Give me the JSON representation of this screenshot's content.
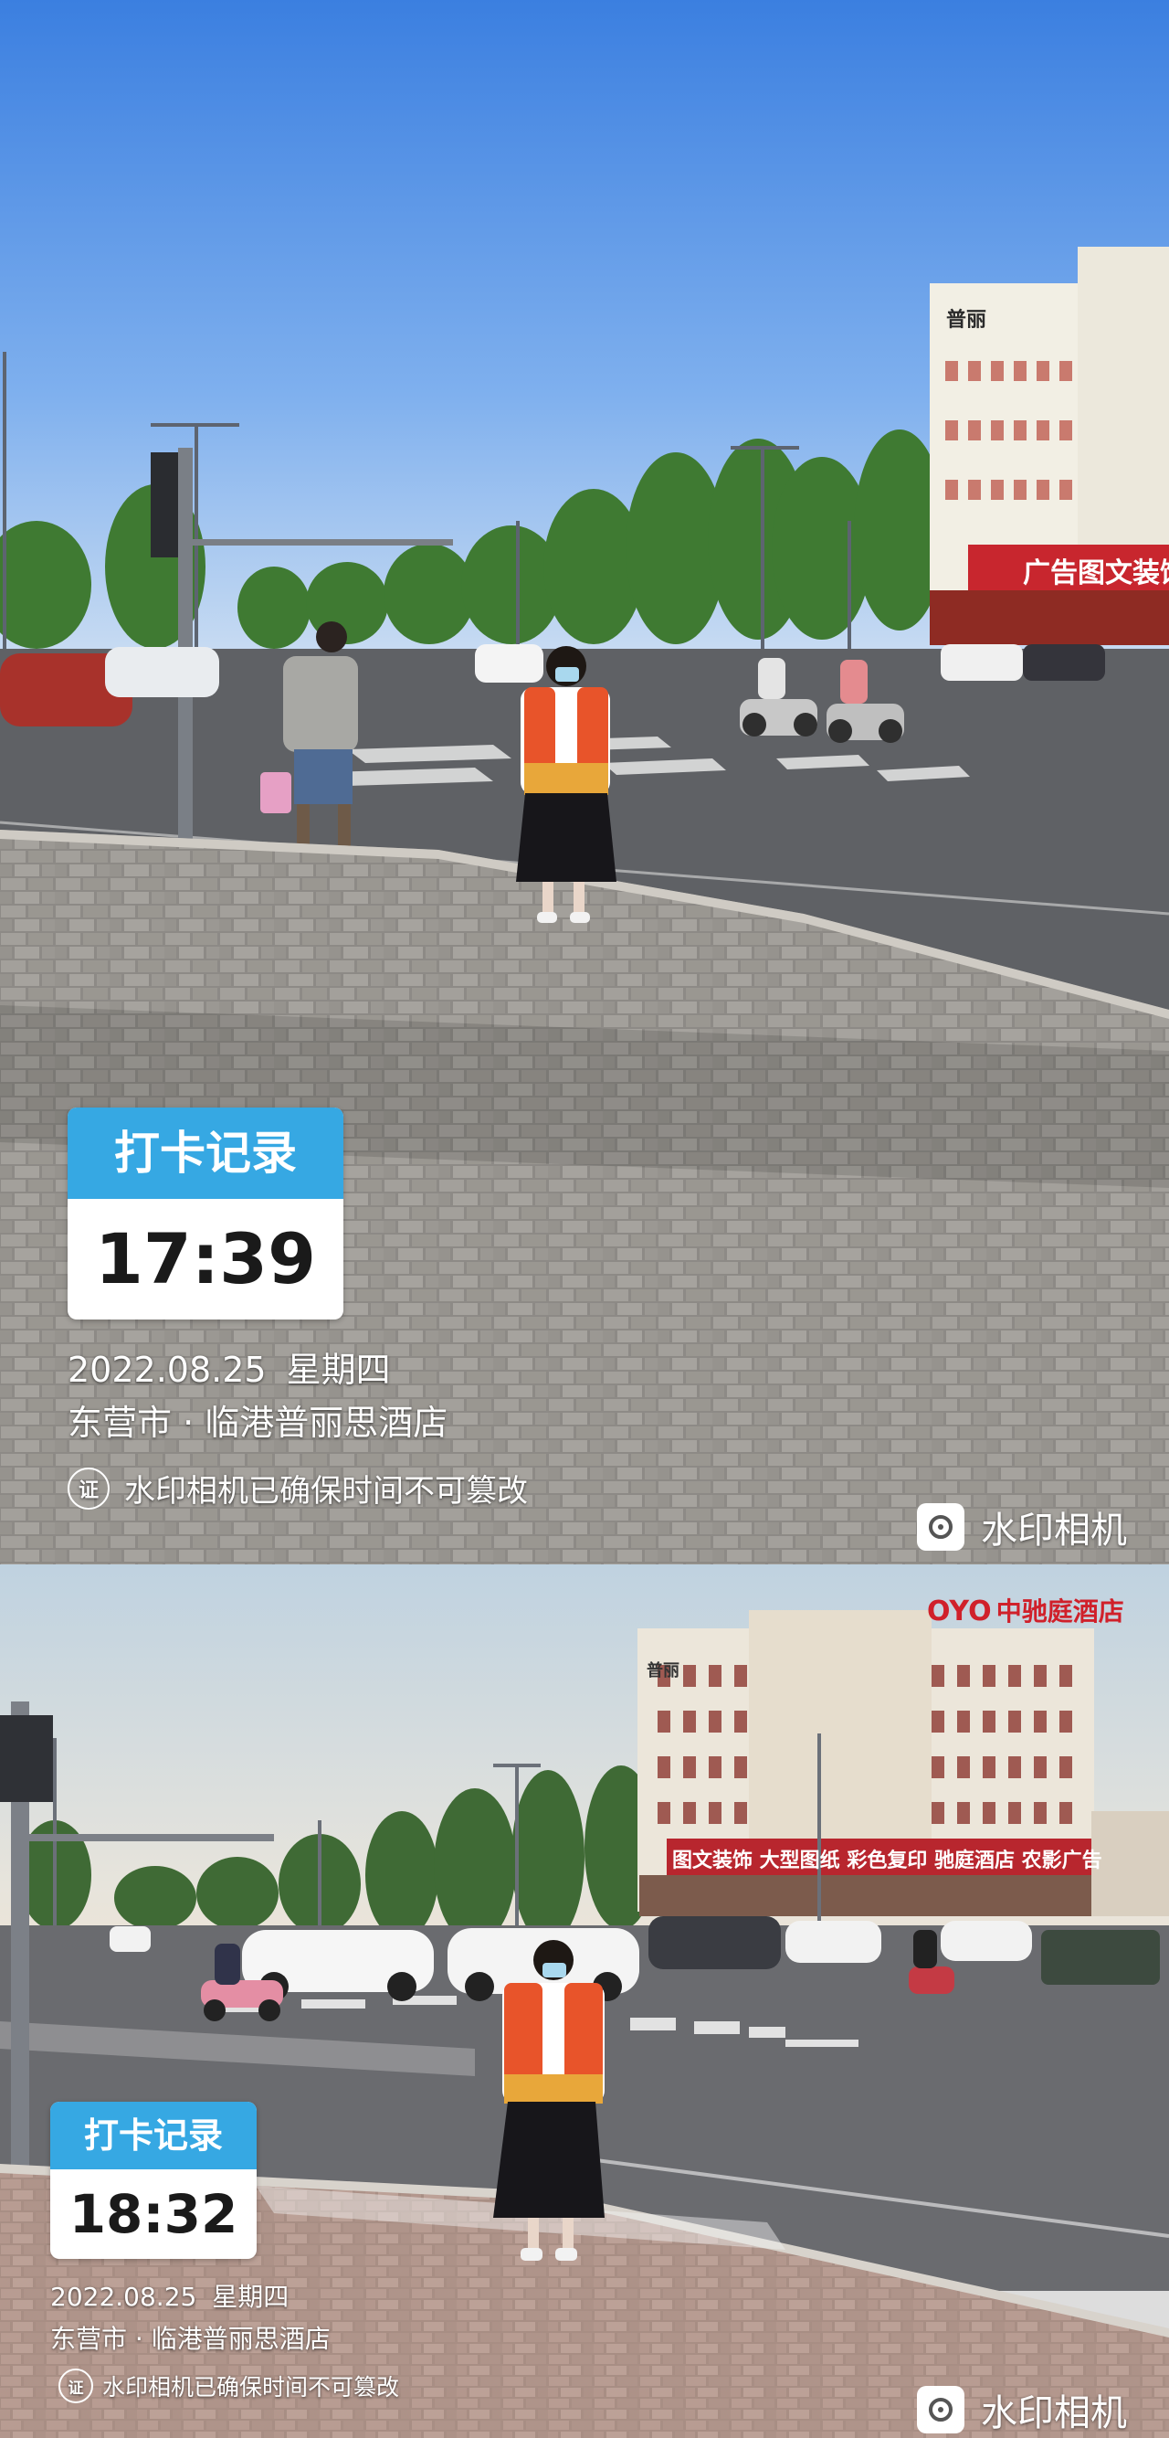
{
  "photos": [
    {
      "stamp_title": "打卡记录",
      "time": "17:39",
      "date": "2022.08.25",
      "weekday": "星期四",
      "location": "东营市 · 临港普丽思酒店",
      "cert_icon_label": "证",
      "cert_text": "水印相机已确保时间不可篡改",
      "brand": "水印相机",
      "building_sign": "广告图文装饰",
      "building_top_sign": "普丽"
    },
    {
      "stamp_title": "打卡记录",
      "time": "18:32",
      "date": "2022.08.25",
      "weekday": "星期四",
      "location": "东营市 · 临港普丽思酒店",
      "cert_icon_label": "证",
      "cert_text": "水印相机已确保时间不可篡改",
      "brand": "水印相机",
      "hotel_sign_oyo": "OYO",
      "hotel_sign_name": "中驰庭酒店",
      "shopfront_sign": "图文装饰 大型图纸 彩色复印 驰庭酒店 农影广告",
      "building_top_sign": "普丽"
    }
  ],
  "colors": {
    "stamp_header": "#36a8e3",
    "vest": "#e8542a",
    "sign_red": "#d0202a"
  }
}
